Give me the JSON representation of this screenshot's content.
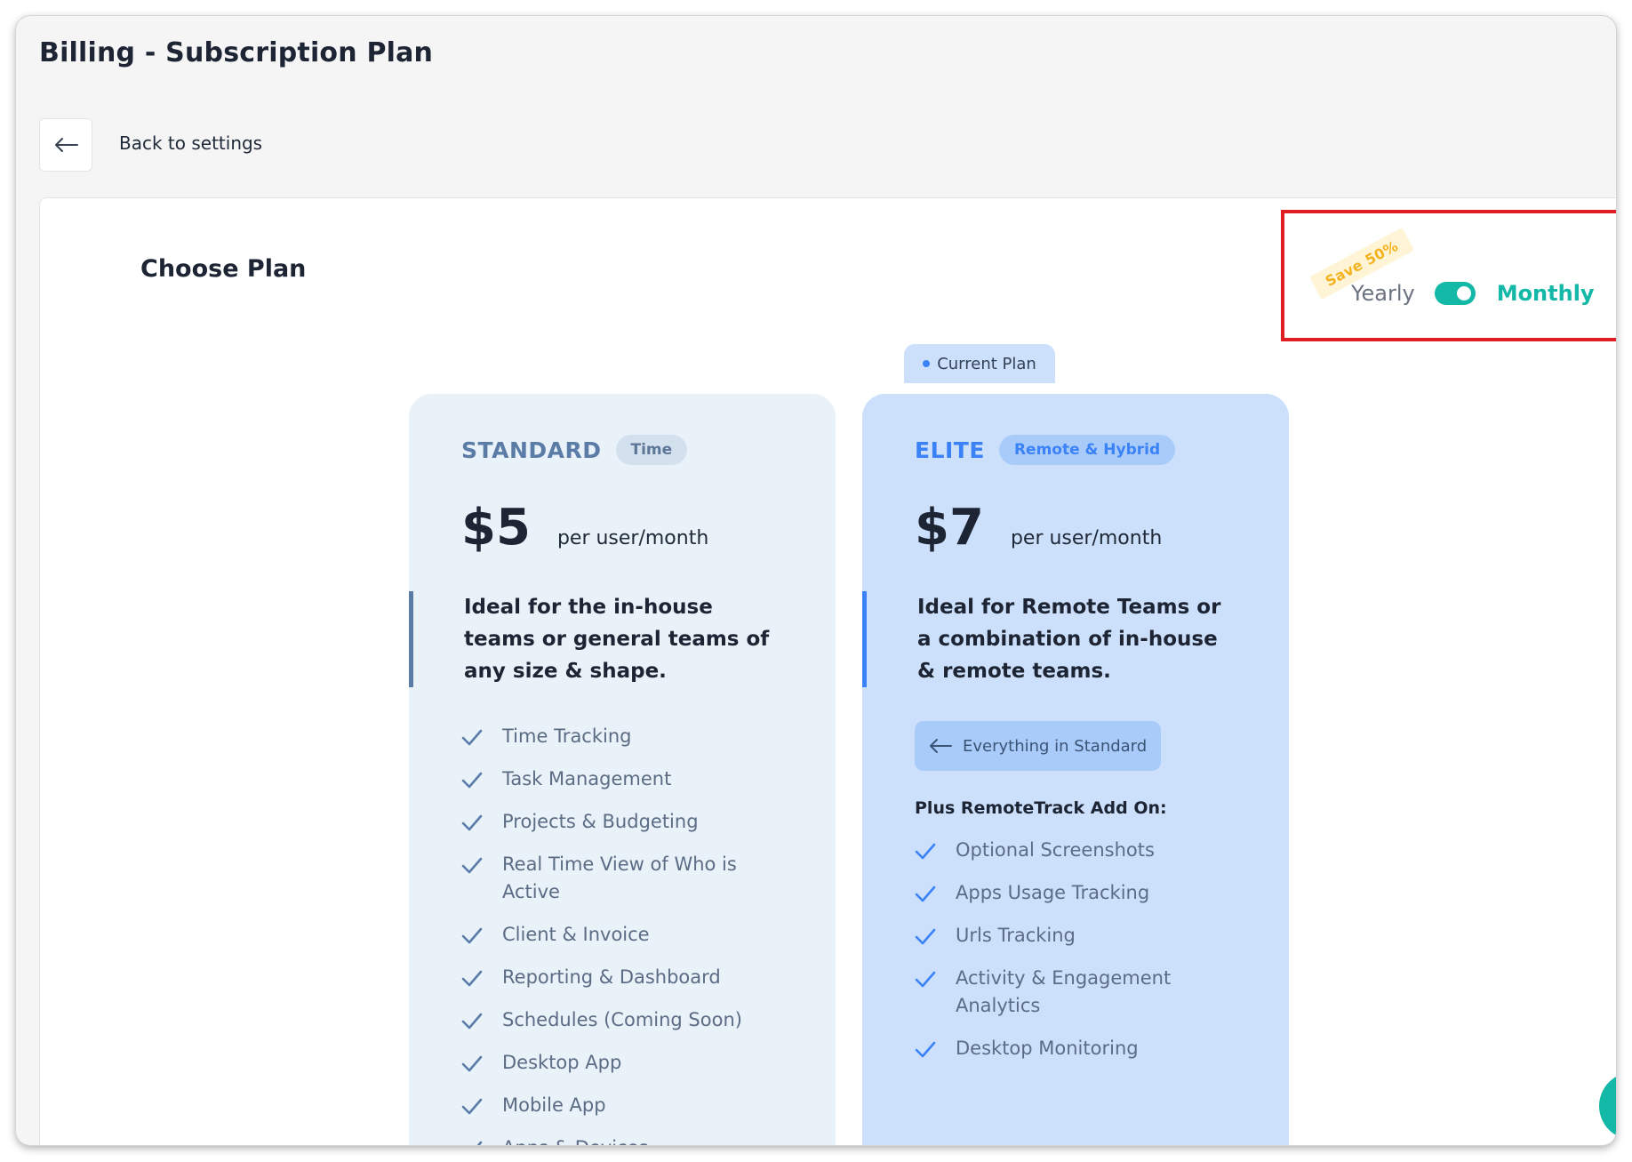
{
  "page": {
    "title": "Billing - Subscription Plan",
    "back_label": "Back to settings"
  },
  "panel": {
    "title": "Choose Plan"
  },
  "billing_toggle": {
    "badge": "Save 50%",
    "yearly_label": "Yearly",
    "monthly_label": "Monthly",
    "selected": "Monthly"
  },
  "plans": [
    {
      "name": "STANDARD",
      "tag": "Time",
      "price": "$5",
      "per": "per user/month",
      "description": "Ideal for the in-house teams or general teams of any size & shape.",
      "features": [
        "Time Tracking",
        "Task Management",
        "Projects & Budgeting",
        "Real Time View of Who is Active",
        "Client & Invoice",
        "Reporting & Dashboard",
        "Schedules (Coming Soon)",
        "Desktop App",
        "Mobile App",
        "Apps & Devices"
      ]
    },
    {
      "name": "ELITE",
      "tag": "Remote & Hybrid",
      "current_label": "Current Plan",
      "price": "$7",
      "per": "per user/month",
      "description": "Ideal for Remote Teams or a combination of in-house & remote teams.",
      "everything_label": "Everything in Standard",
      "plus_label": "Plus RemoteTrack Add On:",
      "features": [
        "Optional Screenshots",
        "Apps Usage Tracking",
        "Urls Tracking",
        "Activity & Engagement Analytics",
        "Desktop Monitoring"
      ]
    }
  ],
  "colors": {
    "accent_teal": "#14b8a6",
    "elite_blue": "#3b82f6",
    "highlight_red": "#e11d24"
  }
}
